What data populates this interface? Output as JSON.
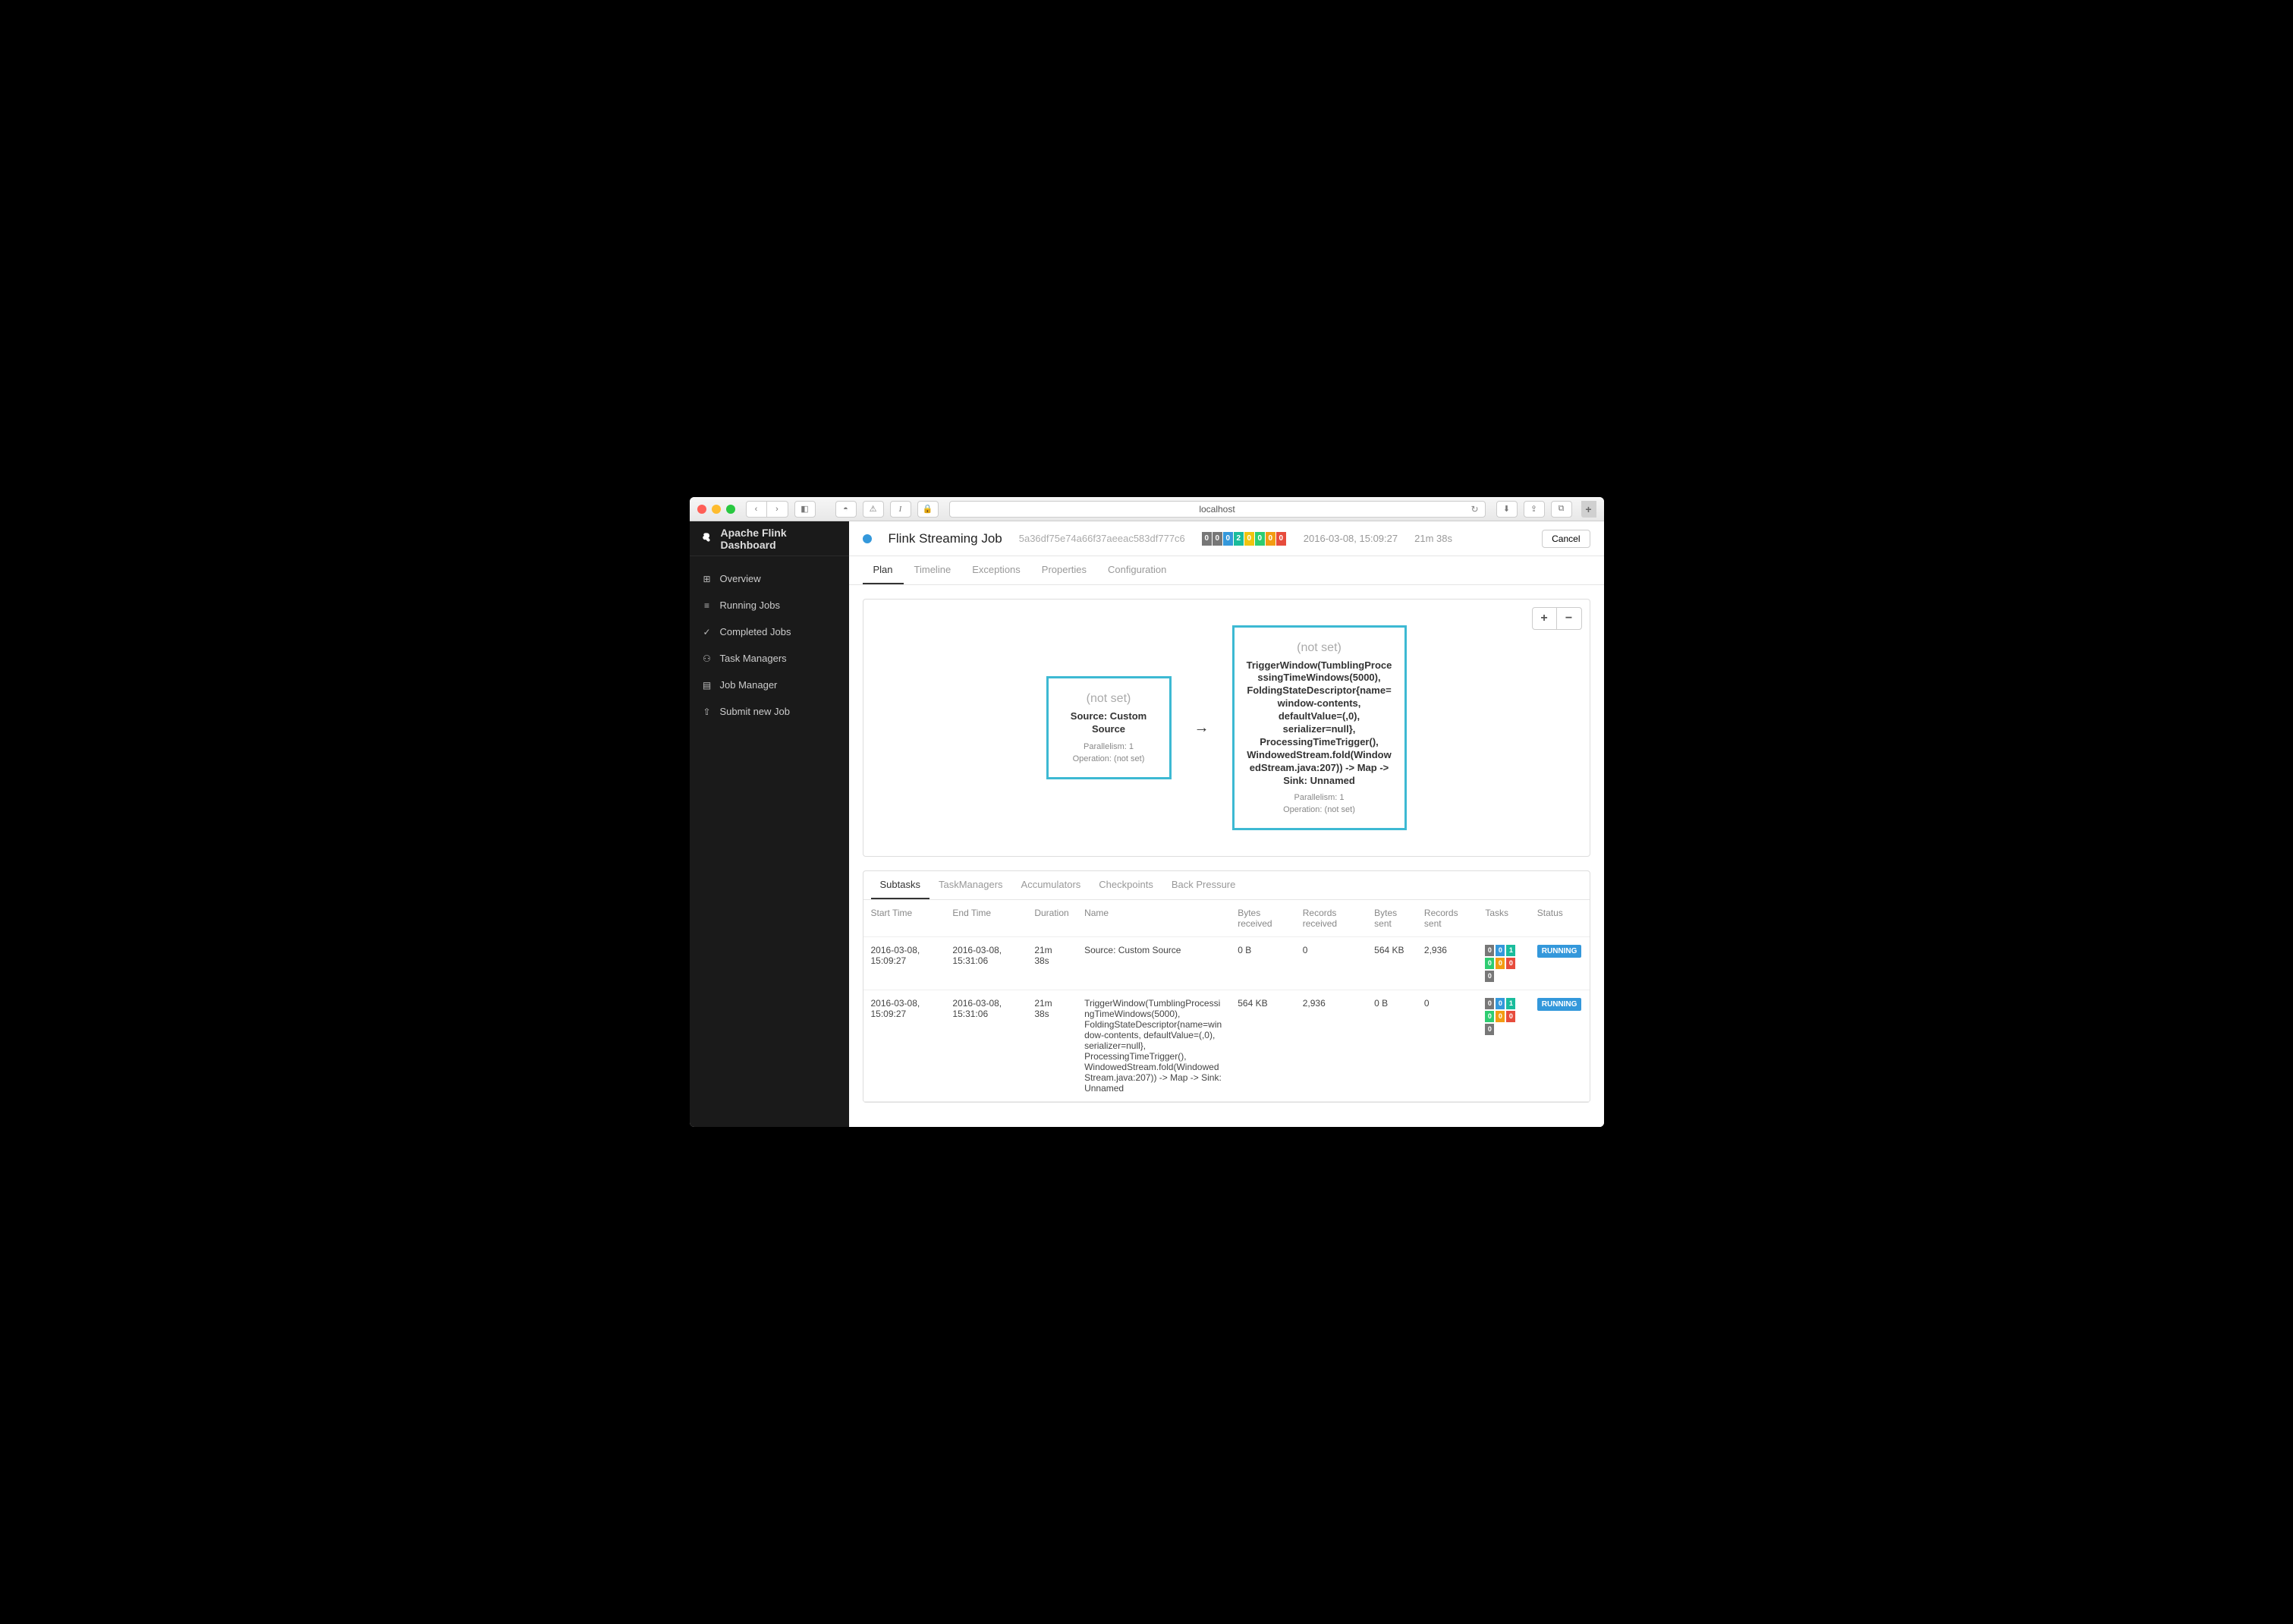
{
  "browser": {
    "url": "localhost",
    "traffic": [
      "close",
      "minimize",
      "maximize"
    ]
  },
  "sidebar": {
    "title": "Apache Flink Dashboard",
    "items": [
      {
        "icon": "dashboard-icon",
        "label": "Overview"
      },
      {
        "icon": "list-icon",
        "label": "Running Jobs"
      },
      {
        "icon": "check-icon",
        "label": "Completed Jobs"
      },
      {
        "icon": "sitemap-icon",
        "label": "Task Managers"
      },
      {
        "icon": "server-icon",
        "label": "Job Manager"
      },
      {
        "icon": "upload-icon",
        "label": "Submit new Job"
      }
    ]
  },
  "topbar": {
    "job_title": "Flink Streaming Job",
    "job_id": "5a36df75e74a66f37aeeac583df777c6",
    "counters": [
      "0",
      "0",
      "0",
      "2",
      "0",
      "0",
      "0",
      "0"
    ],
    "timestamp": "2016-03-08, 15:09:27",
    "duration": "21m 38s",
    "cancel_label": "Cancel"
  },
  "tabs": [
    "Plan",
    "Timeline",
    "Exceptions",
    "Properties",
    "Configuration"
  ],
  "plan": {
    "zoom_in": "+",
    "zoom_out": "−",
    "node1": {
      "notset": "(not set)",
      "title": "Source: Custom Source",
      "parallelism": "Parallelism: 1",
      "operation": "Operation: (not set)"
    },
    "node2": {
      "notset": "(not set)",
      "title": "TriggerWindow(TumblingProcessingTimeWindows(5000), FoldingStateDescriptor{name=window-contents, defaultValue=(,0), serializer=null}, ProcessingTimeTrigger(), WindowedStream.fold(WindowedStream.java:207)) -> Map -> Sink: Unnamed",
      "parallelism": "Parallelism: 1",
      "operation": "Operation: (not set)"
    }
  },
  "subtabs": [
    "Subtasks",
    "TaskManagers",
    "Accumulators",
    "Checkpoints",
    "Back Pressure"
  ],
  "table": {
    "headers": [
      "Start Time",
      "End Time",
      "Duration",
      "Name",
      "Bytes received",
      "Records received",
      "Bytes sent",
      "Records sent",
      "Tasks",
      "Status"
    ],
    "rows": [
      {
        "start": "2016-03-08, 15:09:27",
        "end": "2016-03-08, 15:31:06",
        "duration": "21m 38s",
        "name": "Source: Custom Source",
        "bytes_recv": "0 B",
        "records_recv": "0",
        "bytes_sent": "564 KB",
        "records_sent": "2,936",
        "tasks": [
          "0",
          "0",
          "1",
          "0",
          "0",
          "0",
          "0"
        ],
        "status": "RUNNING"
      },
      {
        "start": "2016-03-08, 15:09:27",
        "end": "2016-03-08, 15:31:06",
        "duration": "21m 38s",
        "name": "TriggerWindow(TumblingProcessingTimeWindows(5000), FoldingStateDescriptor{name=window-contents, defaultValue=(,0), serializer=null}, ProcessingTimeTrigger(), WindowedStream.fold(WindowedStream.java:207)) -> Map -> Sink: Unnamed",
        "bytes_recv": "564 KB",
        "records_recv": "2,936",
        "bytes_sent": "0 B",
        "records_sent": "0",
        "tasks": [
          "0",
          "0",
          "1",
          "0",
          "0",
          "0",
          "0"
        ],
        "status": "RUNNING"
      }
    ]
  }
}
